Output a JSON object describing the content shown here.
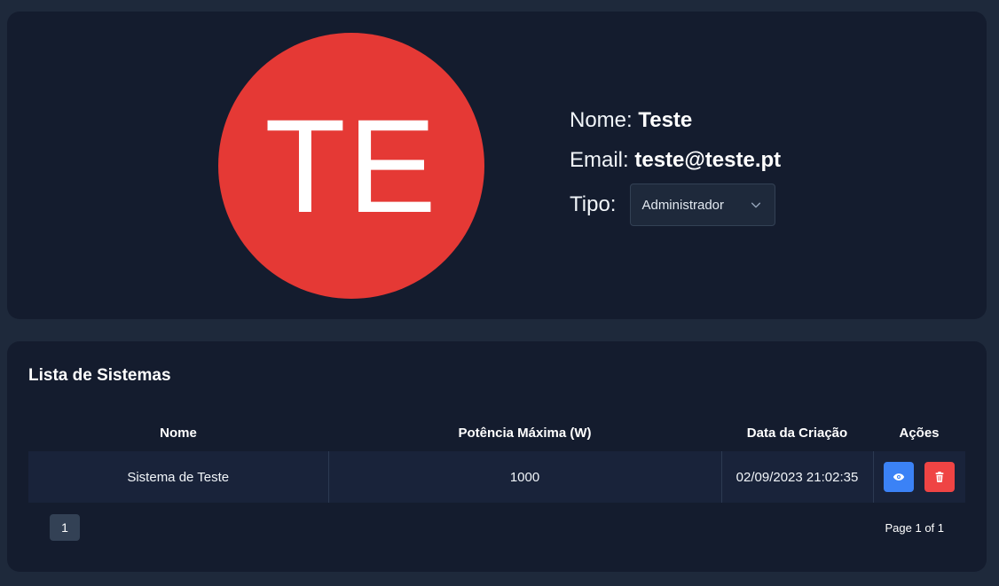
{
  "profile": {
    "initials": "TE",
    "name_label": "Nome:",
    "name_value": "Teste",
    "email_label": "Email:",
    "email_value": "teste@teste.pt",
    "type_label": "Tipo:",
    "type_selected": "Administrador",
    "avatar_color": "#e53935"
  },
  "systems": {
    "title": "Lista de Sistemas",
    "columns": [
      "Nome",
      "Potência Máxima (W)",
      "Data da Criação",
      "Ações"
    ],
    "rows": [
      {
        "name": "Sistema de Teste",
        "max_power": "1000",
        "created": "02/09/2023 21:02:35"
      }
    ],
    "actions": {
      "view_icon": "eye-icon",
      "delete_icon": "trash-icon",
      "view_color": "#3b82f6",
      "delete_color": "#ef4444"
    }
  },
  "pagination": {
    "current_page": "1",
    "page_info": "Page 1 of 1"
  }
}
